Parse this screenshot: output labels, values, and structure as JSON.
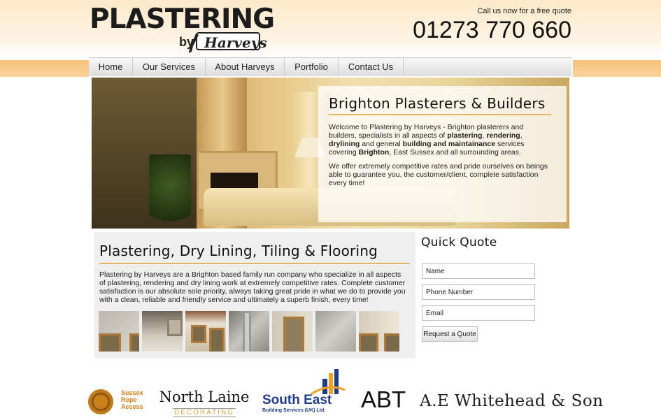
{
  "header": {
    "logo_main": "PLASTERING",
    "logo_by": "by",
    "logo_name": "Harveys",
    "call_text": "Call us now for a free quote",
    "phone": "01273 770 660"
  },
  "nav": {
    "items": [
      {
        "label": "Home"
      },
      {
        "label": "Our Services"
      },
      {
        "label": "About Harveys"
      },
      {
        "label": "Portfolio"
      },
      {
        "label": "Contact Us"
      }
    ]
  },
  "hero": {
    "title": "Brighton Plasterers & Builders",
    "p1": {
      "t1": "Welcome to Plastering by Harveys - Brighton plasterers and builders, specialists in all aspects of ",
      "b1": "plastering",
      "t2": ", ",
      "b2": "rendering",
      "t3": ", ",
      "b3": "drylining",
      "t4": " and general ",
      "b4": "building and maintainance",
      "t5": " services covering ",
      "b5": "Brighton",
      "t6": ", East Sussex and all surrounding areas."
    },
    "p2": "We offer extremely competitive rates and pride ourselves on beings able to guarantee you, the customer/client, complete satisfaction every time!"
  },
  "content": {
    "title": "Plastering, Dry Lining, Tiling & Flooring",
    "body": "Plastering by Harveys are a Brighton based family run company who specialize in all aspects of plastering, rendering and dry lining work at extremely competitive rates. Complete customer satisfaction is our absolute sole priority, always taking great pride in what we do to provide you with a clean, reliable and friendly service and ultimately a superb finish, every time!"
  },
  "quick_quote": {
    "title": "Quick Quote",
    "name_value": "Name",
    "phone_value": "Phone Number",
    "email_value": "Email",
    "button_label": "Request a Quote"
  },
  "partners": {
    "sussex_rope": [
      "Sussex",
      "Rope",
      "Access"
    ],
    "north_laine": {
      "main": "North Laine",
      "sub": "DECORATING"
    },
    "south_east": {
      "main": "South East",
      "sub": "Building Services (UK) Ltd."
    },
    "abt": "ABT",
    "whitehead": "A.E Whitehead & Son"
  },
  "colors": {
    "accent_rule": "#e9b35f",
    "band": "#f6c27a",
    "south_east_blue": "#1f3c86",
    "sussex_orange": "#d77b14"
  }
}
